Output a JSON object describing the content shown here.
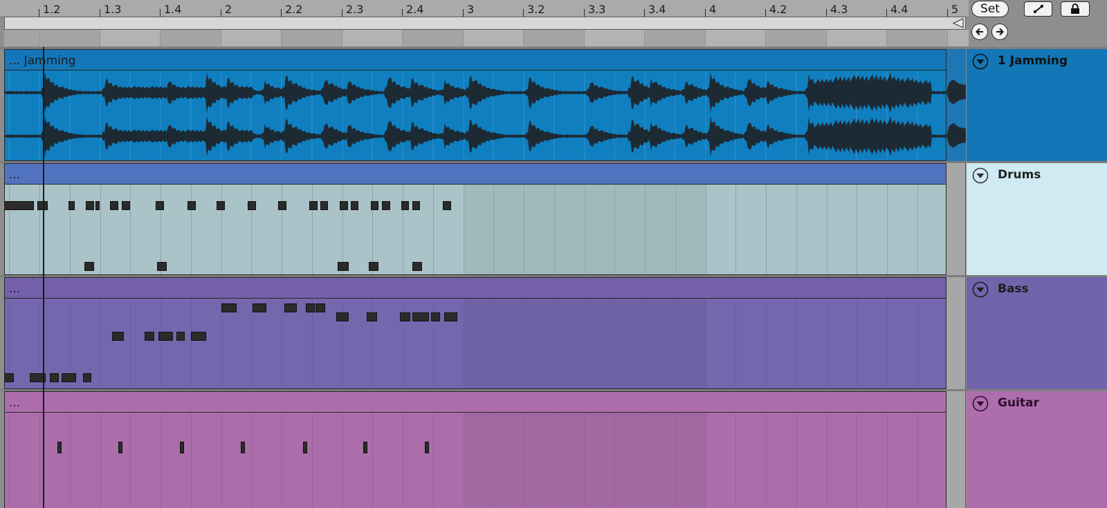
{
  "ruler": {
    "labels": [
      "1.2",
      "1.3",
      "1.4",
      "2",
      "2.2",
      "2.3",
      "2.4",
      "3",
      "3.2",
      "3.3",
      "3.4",
      "4",
      "4.2",
      "4.3",
      "4.4",
      "5"
    ]
  },
  "controls": {
    "set_label": "Set",
    "icons": [
      "draw-mode-icon",
      "lock-icon",
      "arrow-left-icon",
      "arrow-right-icon"
    ]
  },
  "tracks": [
    {
      "name": "1 Jamming",
      "clip_title": "... Jamming",
      "type": "audio",
      "color": "#1477b9",
      "clip_color": "#0f7fc0",
      "panel_color": "#1377b7",
      "grid_color": "#3a8fc9",
      "name_color": "#111111"
    },
    {
      "name": "Drums",
      "clip_title": "...",
      "type": "midi",
      "color": "#5274c0",
      "clip_color": "#a9c3c8",
      "panel_color": "#cfeaf2",
      "grid_color": "#8ea6ab",
      "name_color": "#222222",
      "notes": [
        [
          0.4,
          0.9,
          2.4
        ],
        [
          0.97,
          1.14,
          2.4
        ],
        [
          1.48,
          1.58,
          2.4
        ],
        [
          1.76,
          1.9,
          2.4
        ],
        [
          1.92,
          1.99,
          2.4
        ],
        [
          2.16,
          2.3,
          2.4
        ],
        [
          2.36,
          2.5,
          2.4
        ],
        [
          2.92,
          3.06,
          2.4
        ],
        [
          3.44,
          3.58,
          2.4
        ],
        [
          3.92,
          4.06,
          2.4
        ],
        [
          4.44,
          4.58,
          2.4
        ],
        [
          4.94,
          5.08,
          2.4
        ],
        [
          5.46,
          5.6,
          2.4
        ],
        [
          5.64,
          5.77,
          2.4
        ],
        [
          5.96,
          6.1,
          2.4
        ],
        [
          6.14,
          6.27,
          2.4
        ],
        [
          6.47,
          6.6,
          2.4
        ],
        [
          6.66,
          6.8,
          2.4
        ],
        [
          6.98,
          7.1,
          2.4
        ],
        [
          7.16,
          7.28,
          2.4
        ],
        [
          7.66,
          7.8,
          2.4
        ],
        [
          1.74,
          1.9,
          10.4
        ],
        [
          2.94,
          3.1,
          10.4
        ],
        [
          5.92,
          6.1,
          10.4
        ],
        [
          6.44,
          6.6,
          10.4
        ],
        [
          7.16,
          7.32,
          10.4
        ],
        [
          0.45,
          0.65,
          12.4
        ],
        [
          0.95,
          1.12,
          12.4
        ],
        [
          1.44,
          1.6,
          12.4
        ],
        [
          1.94,
          2.1,
          12.4
        ],
        [
          2.44,
          2.6,
          12.4
        ],
        [
          2.96,
          3.13,
          12.4
        ],
        [
          3.46,
          3.63,
          12.4
        ],
        [
          3.96,
          4.13,
          12.4
        ],
        [
          4.46,
          4.63,
          12.4
        ],
        [
          4.96,
          5.13,
          12.4
        ],
        [
          5.46,
          5.63,
          12.4
        ],
        [
          6.06,
          6.23,
          12.4
        ],
        [
          6.58,
          6.74,
          12.4
        ],
        [
          7.17,
          7.33,
          12.4
        ],
        [
          7.66,
          7.83,
          12.4
        ]
      ]
    },
    {
      "name": "Bass",
      "clip_title": "...",
      "type": "midi",
      "color": "#7460ab",
      "clip_color": "#7467ad",
      "panel_color": "#7164ab",
      "grid_color": "#6a5da1",
      "name_color": "#1c1c1c",
      "notes": [
        [
          4.0,
          4.25,
          0.8
        ],
        [
          4.52,
          4.75,
          0.8
        ],
        [
          5.04,
          5.25,
          0.8
        ],
        [
          5.4,
          5.55,
          0.8
        ],
        [
          5.56,
          5.72,
          0.8
        ],
        [
          5.9,
          6.1,
          2.0
        ],
        [
          6.41,
          6.58,
          2.0
        ],
        [
          6.95,
          7.12,
          2.0
        ],
        [
          7.16,
          7.43,
          2.0
        ],
        [
          7.47,
          7.62,
          2.0
        ],
        [
          7.68,
          7.9,
          2.0
        ],
        [
          2.2,
          2.4,
          4.5
        ],
        [
          2.74,
          2.9,
          4.5
        ],
        [
          2.96,
          3.2,
          4.5
        ],
        [
          3.26,
          3.4,
          4.5
        ],
        [
          3.5,
          3.75,
          4.5
        ],
        [
          0.0,
          0.05,
          10.0
        ],
        [
          0.33,
          0.58,
          10.0
        ],
        [
          0.84,
          1.1,
          10.0
        ],
        [
          1.17,
          1.32,
          10.0
        ],
        [
          1.36,
          1.6,
          10.0
        ],
        [
          1.72,
          1.86,
          10.0
        ]
      ]
    },
    {
      "name": "Guitar",
      "clip_title": "...",
      "type": "midi",
      "color": "#ae6eae",
      "clip_color": "#ab6eab",
      "panel_color": "#ae6eae",
      "grid_color": "#9a5e9a",
      "name_color": "#2a0f2a",
      "notes": [
        [
          0.26,
          0.33,
          4.0
        ],
        [
          1.3,
          1.36,
          4.0
        ],
        [
          2.3,
          2.36,
          4.0
        ],
        [
          3.32,
          3.38,
          4.0
        ],
        [
          4.33,
          4.38,
          4.0
        ],
        [
          5.35,
          5.41,
          4.0
        ],
        [
          6.35,
          6.41,
          4.0
        ],
        [
          7.37,
          7.43,
          4.0
        ]
      ]
    }
  ]
}
